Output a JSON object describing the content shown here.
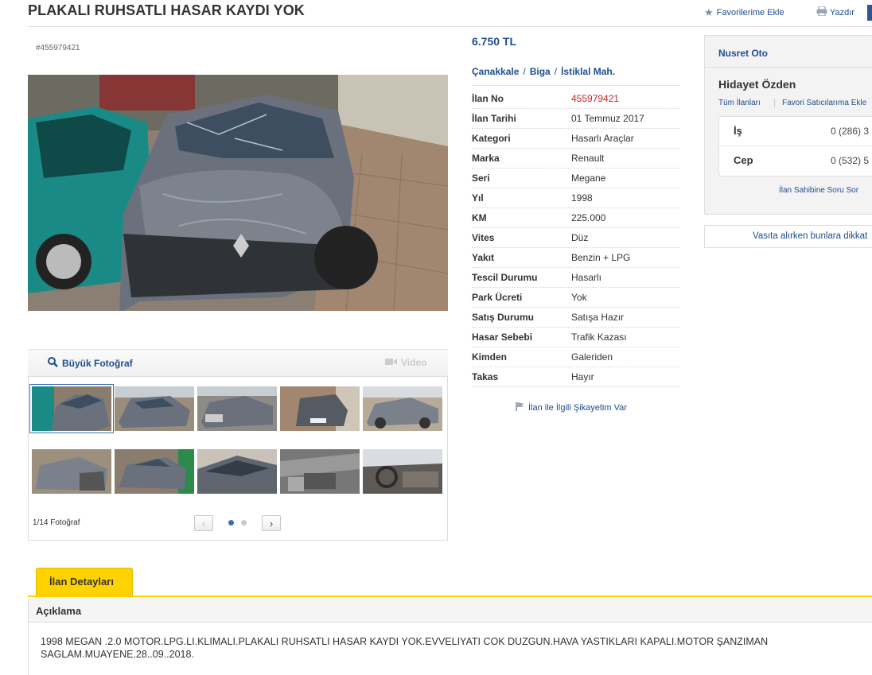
{
  "header": {
    "title": "PLAKALI RUHSATLI HASAR KAYDI YOK",
    "favorite_label": "Favorilerime Ekle",
    "print_label": "Yazdır"
  },
  "gallery": {
    "listing_id": "#455979421",
    "big_photo_label": "Büyük Fotoğraf",
    "video_label": "Video",
    "photo_count": "1/14 Fotoğraf",
    "prev_label": "‹",
    "next_label": "›"
  },
  "info": {
    "price": "6.750 TL",
    "location": [
      "Çanakkale",
      "Biga",
      "İstiklal Mah."
    ],
    "location_sep": "/",
    "rows": [
      {
        "k": "İlan No",
        "v": "455979421"
      },
      {
        "k": "İlan Tarihi",
        "v": "01 Temmuz 2017"
      },
      {
        "k": "Kategori",
        "v": "Hasarlı Araçlar"
      },
      {
        "k": "Marka",
        "v": "Renault"
      },
      {
        "k": "Seri",
        "v": "Megane"
      },
      {
        "k": "Yıl",
        "v": "1998"
      },
      {
        "k": "KM",
        "v": "225.000"
      },
      {
        "k": "Vites",
        "v": "Düz"
      },
      {
        "k": "Yakıt",
        "v": "Benzin + LPG"
      },
      {
        "k": "Tescil Durumu",
        "v": "Hasarlı"
      },
      {
        "k": "Park Ücreti",
        "v": "Yok"
      },
      {
        "k": "Satış Durumu",
        "v": "Satışa Hazır"
      },
      {
        "k": "Hasar Sebebi",
        "v": "Trafik Kazası"
      },
      {
        "k": "Kimden",
        "v": "Galeriden"
      },
      {
        "k": "Takas",
        "v": "Hayır"
      }
    ],
    "complaint_label": "İlan ile İlgili Şikayetim Var"
  },
  "seller": {
    "store_name": "Nusret Oto",
    "name": "Hidayet Özden",
    "all_ads_label": "Tüm İlanları",
    "favorite_seller_label": "Favori Satıcılarıma Ekle",
    "phones": [
      {
        "k": "İş",
        "v": "0 (286) 3"
      },
      {
        "k": "Cep",
        "v": "0 (532) 5"
      }
    ],
    "ask_label": "İlan Sahibine Soru Sor",
    "tips_label": "Vasıta alırken bunlara dikkat"
  },
  "details": {
    "tab_label": "İlan Detayları",
    "section_label": "Açıklama",
    "description": "1998 MEGAN .2.0 MOTOR.LPG.LI.KLIMALI.PLAKALI RUHSATLI HASAR KAYDI YOK.EVVELIYATI COK DUZGUN.HAVA YASTIKLARI KAPALI.MOTOR  ŞANZIMAN SAGLAM.MUAYENE.28..09..2018."
  },
  "colors": {
    "accent": "#1f4d8f",
    "tab": "#ffd200",
    "listing_no": "#c1272d",
    "car": "#6a717c"
  },
  "icons": [
    "star-icon",
    "printer-icon",
    "search-icon",
    "video-camera-icon",
    "flag-icon",
    "chevron-left-icon",
    "chevron-right-icon"
  ]
}
